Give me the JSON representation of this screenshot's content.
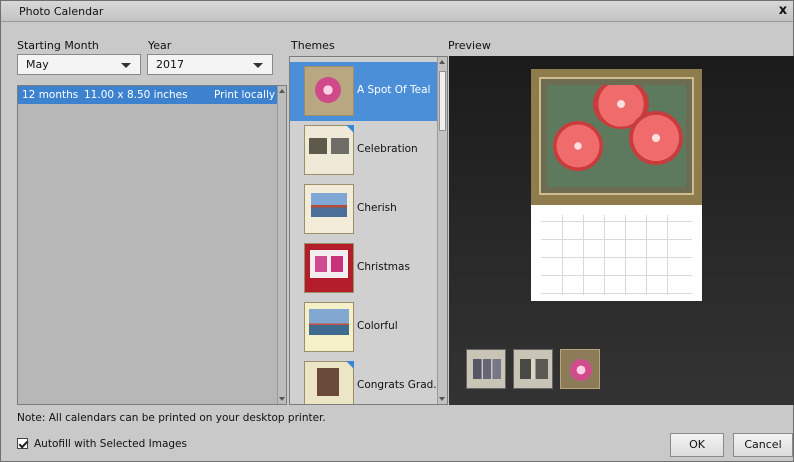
{
  "window": {
    "title": "Photo Calendar",
    "close_glyph": "x"
  },
  "labels": {
    "starting_month": "Starting Month",
    "year": "Year",
    "themes": "Themes",
    "preview": "Preview"
  },
  "starting_month": {
    "value": "May"
  },
  "year": {
    "value": "2017"
  },
  "calendar_list": {
    "rows": [
      {
        "months": "12 months",
        "size": "11.00 x 8.50 inches",
        "print": "Print locally"
      }
    ]
  },
  "themes": {
    "items": [
      {
        "name": "A Spot Of Teal",
        "selected": true
      },
      {
        "name": "Celebration",
        "selected": false
      },
      {
        "name": "Cherish",
        "selected": false
      },
      {
        "name": "Christmas",
        "selected": false
      },
      {
        "name": "Colorful",
        "selected": false
      },
      {
        "name": "Congrats Grad...",
        "selected": false
      }
    ]
  },
  "note": "Note: All calendars can be printed on your desktop printer.",
  "autofill": {
    "label": "Autofill with Selected Images",
    "checked": true
  },
  "buttons": {
    "ok": "OK",
    "cancel": "Cancel"
  },
  "colors": {
    "selection": "#3d82cf",
    "accent_corner": "#3a86d4"
  }
}
